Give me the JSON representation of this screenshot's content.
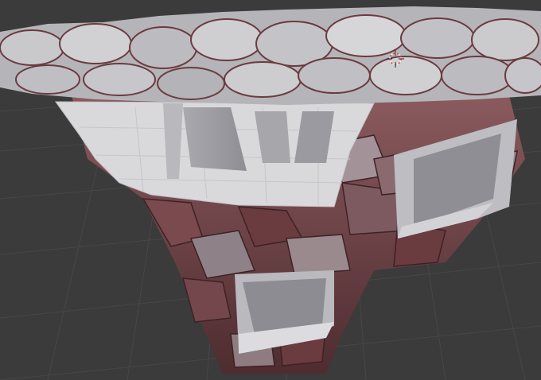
{
  "viewport": {
    "label": "",
    "shading": "solid"
  },
  "scene": {
    "objects": [
      {
        "id": "rock-terrain-mesh"
      },
      {
        "id": "carved-interior-floor"
      }
    ]
  },
  "cursor": {
    "type": "3d-cursor",
    "icon": "crosshair-icon"
  },
  "colors": {
    "background": "#3b3b3b",
    "grid_line": "#474747",
    "rock_light": "#c9c9cc",
    "rock_dark": "#6a3b3f",
    "rock_mid": "#9a8a8e",
    "floor": "#d9d9dc",
    "wall": "#9e9ea4",
    "cursor_red": "#e23a2c"
  }
}
